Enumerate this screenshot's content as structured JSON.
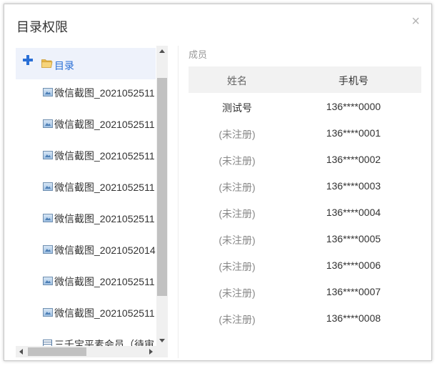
{
  "dialog": {
    "title": "目录权限",
    "close_glyph": "×"
  },
  "tree": {
    "root": {
      "label": "目录",
      "icon": "folder-open-icon",
      "expand_icon": "plus-icon"
    },
    "items": [
      {
        "label": "微信截图_2021052511",
        "icon": "image-file-icon"
      },
      {
        "label": "微信截图_2021052511",
        "icon": "image-file-icon"
      },
      {
        "label": "微信截图_2021052511",
        "icon": "image-file-icon"
      },
      {
        "label": "微信截图_2021052511",
        "icon": "image-file-icon"
      },
      {
        "label": "微信截图_2021052511",
        "icon": "image-file-icon"
      },
      {
        "label": "微信截图_2021052014",
        "icon": "image-file-icon"
      },
      {
        "label": "微信截图_2021052511",
        "icon": "image-file-icon"
      },
      {
        "label": "微信截图_2021052511",
        "icon": "image-file-icon"
      },
      {
        "label": "三千宝平素会员（待审",
        "icon": "spreadsheet-file-icon"
      }
    ]
  },
  "members": {
    "section_label": "成员",
    "columns": [
      "姓名",
      "手机号"
    ],
    "rows": [
      {
        "name": "测试号",
        "phone": "136****0000",
        "registered": true
      },
      {
        "name": "(未注册)",
        "phone": "136****0001",
        "registered": false
      },
      {
        "name": "(未注册)",
        "phone": "136****0002",
        "registered": false
      },
      {
        "name": "(未注册)",
        "phone": "136****0003",
        "registered": false
      },
      {
        "name": "(未注册)",
        "phone": "136****0004",
        "registered": false
      },
      {
        "name": "(未注册)",
        "phone": "136****0005",
        "registered": false
      },
      {
        "name": "(未注册)",
        "phone": "136****0006",
        "registered": false
      },
      {
        "name": "(未注册)",
        "phone": "136****0007",
        "registered": false
      },
      {
        "name": "(未注册)",
        "phone": "136****0008",
        "registered": false
      }
    ]
  },
  "colors": {
    "accent": "#2a6fd6",
    "selected_row_bg": "#eef2fb",
    "header_bg": "#f2f2f2"
  }
}
